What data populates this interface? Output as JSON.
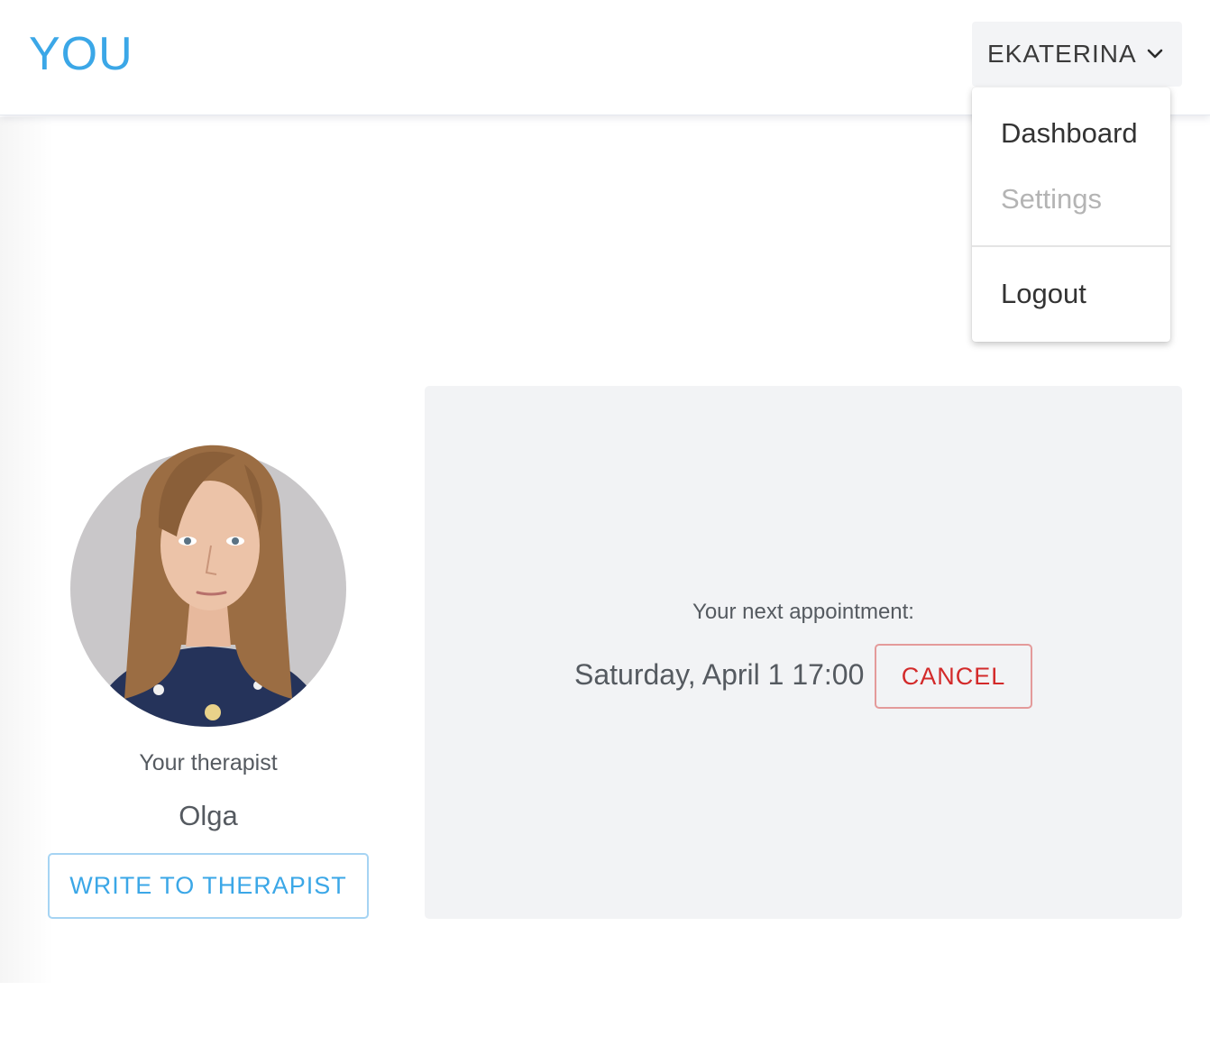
{
  "header": {
    "logo": "YOU",
    "user_menu": {
      "name": "EKATERINA"
    }
  },
  "dropdown": {
    "items": [
      {
        "label": "Dashboard",
        "enabled": true
      },
      {
        "label": "Settings",
        "enabled": false
      },
      {
        "label": "Logout",
        "enabled": true
      }
    ]
  },
  "therapist": {
    "caption": "Your therapist",
    "name": "Olga",
    "write_button": "WRITE TO THERAPIST"
  },
  "appointment": {
    "label": "Your next appointment:",
    "datetime": "Saturday, April 1 17:00",
    "cancel_button": "CANCEL"
  },
  "colors": {
    "accent": "#3ba7e7",
    "danger": "#d32a2a",
    "panel_bg": "#f2f3f5",
    "menu_bg": "#f3f4f6"
  }
}
